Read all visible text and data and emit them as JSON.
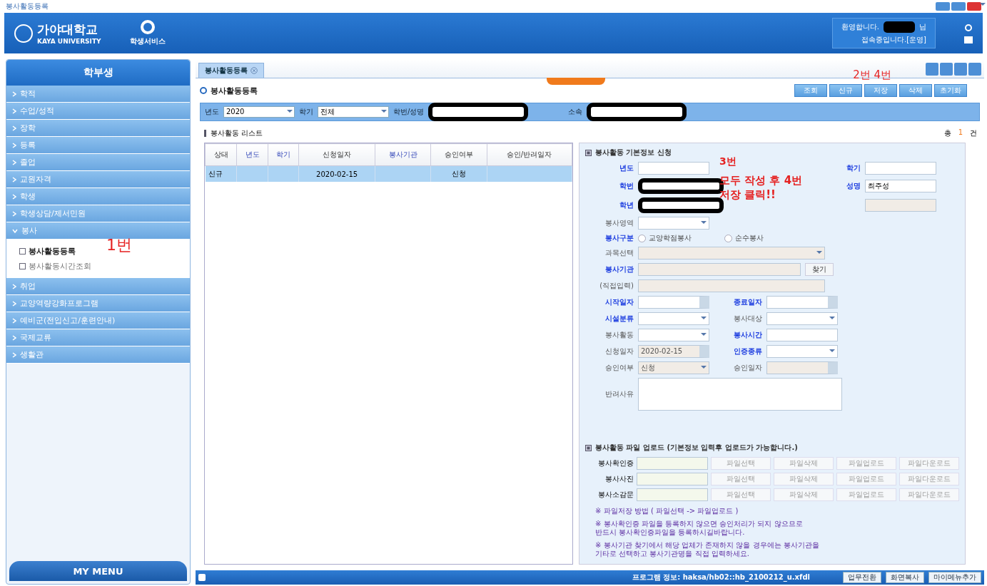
{
  "window": {
    "title": "봉사활동등록"
  },
  "header": {
    "logo_text": "가야대학교",
    "logo_subtext": "KAYA UNIVERSITY",
    "service_label": "학생서비스",
    "welcome": "환영합니다.",
    "user_redacted": true,
    "user_suffix": "님",
    "status": "접속중입니다.[운영]"
  },
  "sidebar": {
    "title": "학부생",
    "items": [
      {
        "label": "학적",
        "expanded": false
      },
      {
        "label": "수업/성적",
        "expanded": false
      },
      {
        "label": "장학",
        "expanded": false
      },
      {
        "label": "등록",
        "expanded": false
      },
      {
        "label": "졸업",
        "expanded": false
      },
      {
        "label": "교원자격",
        "expanded": false
      },
      {
        "label": "학생",
        "expanded": false
      },
      {
        "label": "학생상담/제서민원",
        "expanded": false
      },
      {
        "label": "봉사",
        "expanded": true,
        "children": [
          {
            "label": "봉사활동등록",
            "selected": true
          },
          {
            "label": "봉사활동시간조회",
            "selected": false
          }
        ]
      },
      {
        "label": "취업",
        "expanded": false
      },
      {
        "label": "교양역량강화프로그램",
        "expanded": false
      },
      {
        "label": "예비군(전입신고/훈련안내)",
        "expanded": false
      },
      {
        "label": "국제교류",
        "expanded": false
      },
      {
        "label": "생활관",
        "expanded": false
      }
    ],
    "footer": "MY MENU"
  },
  "tabs": [
    {
      "label": "봉사활동등록",
      "selected": true
    }
  ],
  "page": {
    "title": "봉사활동등록",
    "buttons": [
      "조회",
      "신규",
      "저장",
      "삭제",
      "초기화"
    ]
  },
  "filters": [
    {
      "label": "년도",
      "kind": "select",
      "value": "2020"
    },
    {
      "label": "학기",
      "kind": "select",
      "value": "전체"
    },
    {
      "label": "학번/성명",
      "kind": "text",
      "redacted": true
    },
    {
      "label": "소속",
      "kind": "text",
      "redacted": true
    }
  ],
  "list": {
    "title": "봉사활동 리스트",
    "total_prefix": "총",
    "total": "1",
    "total_suffix": "건",
    "columns": [
      {
        "label": "상태",
        "required": false
      },
      {
        "label": "년도",
        "required": true
      },
      {
        "label": "학기",
        "required": true
      },
      {
        "label": "신청일자",
        "required": false
      },
      {
        "label": "봉사기관",
        "required": true
      },
      {
        "label": "승인여부",
        "required": false
      },
      {
        "label": "승인/반려일자",
        "required": false
      }
    ],
    "rows": [
      {
        "selected": true,
        "cells": [
          "신규",
          null,
          null,
          "2020-02-15",
          null,
          "신청",
          null
        ]
      }
    ]
  },
  "form": {
    "title": "봉사활동 기본정보 신청",
    "rows": [
      [
        {
          "label": "년도",
          "required": true,
          "kind": "text"
        },
        {
          "label": "학기",
          "required": true,
          "kind": "text"
        }
      ],
      [
        {
          "label": "학번",
          "required": true,
          "kind": "text",
          "redacted": true
        },
        {
          "label": "성명",
          "required": true,
          "kind": "text",
          "value": "최주성"
        }
      ],
      [
        {
          "label": "학년",
          "required": true,
          "kind": "text",
          "redacted": true
        },
        {
          "kind": "text",
          "disabled": true
        }
      ],
      [
        {
          "label": "봉사영역",
          "required": false,
          "kind": "select"
        }
      ],
      [
        {
          "label": "봉사구분",
          "required": true,
          "kind": "radio",
          "options": [
            {
              "label": "교양학점봉사",
              "selected": false
            },
            {
              "label": "순수봉사",
              "selected": false
            }
          ]
        }
      ],
      [
        {
          "label": "과목선택",
          "required": false,
          "kind": "long-select",
          "disabled": true
        }
      ],
      [
        {
          "label": "봉사기관",
          "required": true,
          "kind": "search",
          "button": "찾기",
          "disabled": true
        }
      ],
      [
        {
          "label": "(직접입력)",
          "required": false,
          "kind": "long-text",
          "disabled": true
        }
      ],
      [
        {
          "label": "시작일자",
          "required": true,
          "kind": "date"
        },
        {
          "label": "종료일자",
          "required": true,
          "kind": "date"
        }
      ],
      [
        {
          "label": "시설분류",
          "required": true,
          "kind": "select"
        },
        {
          "label": "봉사대상",
          "required": false,
          "kind": "select"
        }
      ],
      [
        {
          "label": "봉사활동",
          "required": false,
          "kind": "select"
        },
        {
          "label": "봉사시간",
          "required": true,
          "kind": "text"
        }
      ],
      [
        {
          "label": "신청일자",
          "required": false,
          "kind": "date",
          "value": "2020-02-15",
          "disabled": true
        },
        {
          "label": "인증종류",
          "required": true,
          "kind": "select"
        }
      ],
      [
        {
          "label": "승인여부",
          "required": false,
          "kind": "select",
          "value": "신청",
          "disabled": true
        },
        {
          "label": "승인일자",
          "required": false,
          "kind": "date",
          "disabled": true
        }
      ],
      [
        {
          "label": "반려사유",
          "required": false,
          "kind": "textarea"
        }
      ]
    ]
  },
  "upload": {
    "title": "봉사활동 파일 업로드 (기본정보 입력후 업로드가 가능합니다.)",
    "rows": [
      {
        "label": "봉사확인증",
        "buttons": [
          "파일선택",
          "파일삭제",
          "파일업로드",
          "파일다운로드"
        ]
      },
      {
        "label": "봉사사진",
        "buttons": [
          "파일선택",
          "파일삭제",
          "파일업로드",
          "파일다운로드"
        ]
      },
      {
        "label": "봉사소감문",
        "buttons": [
          "파일선택",
          "파일삭제",
          "파일업로드",
          "파일다운로드"
        ]
      }
    ],
    "notes": [
      "※ 파일저장 방법 ( 파일선택 -> 파일업로드 )",
      "※ 봉사확인증 파일을 등록하지 않으면 승인처리가 되지 않으므로\n반드시 봉사확인증파일을 등록하시길바랍니다.",
      "※ 봉사기관 찾기에서 해당 업체가 존재하지 않을 경우에는 봉사기관을\n기타로 선택하고 봉사기관명을 직접 입력하세요."
    ]
  },
  "annotations": {
    "sidebar": "1번",
    "buttons": "2번 4번",
    "form_step": "3번",
    "form_note": "모두 작성 후 4번\n저장 클릭!!"
  },
  "status_bar": {
    "program_info": "프로그램 정보: haksa/hb02::hb_2100212_u.xfdl",
    "buttons": [
      "업무전환",
      "화면복사",
      "마이메뉴추가"
    ]
  }
}
